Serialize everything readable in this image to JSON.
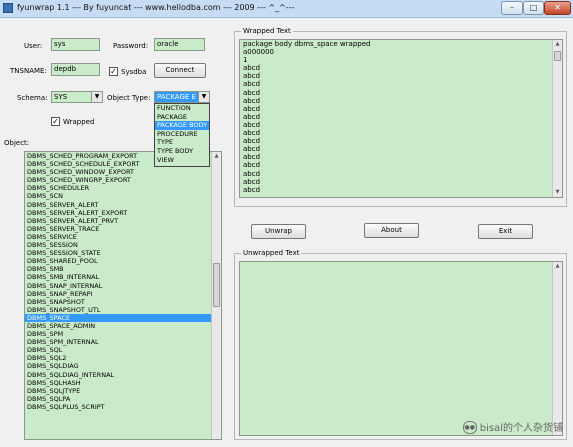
{
  "window": {
    "title": "fyunwrap 1.1 --- By fuyuncat --- www.hellodba.com --- 2009 --- ^_^---",
    "minimize_icon": "minimize-icon",
    "maximize_icon": "maximize-icon",
    "close_icon": "close-icon"
  },
  "login": {
    "user_label": "User:",
    "user_value": "sys",
    "password_label": "Password:",
    "password_value": "oracle",
    "tnsname_label": "TNSNAME:",
    "tnsname_value": "depdb",
    "sysdba_label": "Sysdba",
    "sysdba_checked": true,
    "connect_label": "Connect"
  },
  "schema": {
    "label": "Schema:",
    "value": "SYS"
  },
  "object_type": {
    "label": "Object Type:",
    "value": "PACKAGE E",
    "options": [
      "FUNCTION",
      "PACKAGE",
      "PACKAGE BODY",
      "PROCEDURE",
      "TYPE",
      "TYPE BODY",
      "VIEW"
    ],
    "selected_index": 2
  },
  "wrapped_checkbox": {
    "label": "Wrapped",
    "checked": true
  },
  "objects": {
    "label": "Object:",
    "items": [
      "DBMS_SCHED_PROGRAM_EXPORT",
      "DBMS_SCHED_SCHEDULE_EXPORT",
      "DBMS_SCHED_WINDOW_EXPORT",
      "DBMS_SCHED_WINGRP_EXPORT",
      "DBMS_SCHEDULER",
      "DBMS_SCN",
      "DBMS_SERVER_ALERT",
      "DBMS_SERVER_ALERT_EXPORT",
      "DBMS_SERVER_ALERT_PRVT",
      "DBMS_SERVER_TRACE",
      "DBMS_SERVICE",
      "DBMS_SESSION",
      "DBMS_SESSION_STATE",
      "DBMS_SHARED_POOL",
      "DBMS_SMB",
      "DBMS_SMB_INTERNAL",
      "DBMS_SNAP_INTERNAL",
      "DBMS_SNAP_REPAPI",
      "DBMS_SNAPSHOT",
      "DBMS_SNAPSHOT_UTL",
      "DBMS_SPACE",
      "DBMS_SPACE_ADMIN",
      "DBMS_SPM",
      "DBMS_SPM_INTERNAL",
      "DBMS_SQL",
      "DBMS_SQL2",
      "DBMS_SQLDIAG",
      "DBMS_SQLDIAG_INTERNAL",
      "DBMS_SQLHASH",
      "DBMS_SQLJTYPE",
      "DBMS_SQLPA",
      "DBMS_SQLPLUS_SCRIPT"
    ],
    "selected_index": 20
  },
  "wrapped_text": {
    "caption": "Wrapped Text",
    "lines": [
      "package body dbms_space wrapped",
      "a000000",
      "1",
      "abcd",
      "abcd",
      "abcd",
      "abcd",
      "abcd",
      "abcd",
      "abcd",
      "abcd",
      "abcd",
      "abcd",
      "abcd",
      "abcd",
      "abcd",
      "abcd",
      "abcd",
      "abcd"
    ]
  },
  "buttons": {
    "unwrap": "Unwrap",
    "about": "About",
    "exit": "Exit"
  },
  "unwrapped_text": {
    "caption": "Unwrapped Text"
  },
  "watermark": {
    "text": "bisal的个人杂货铺",
    "icon": "wechat-icon"
  },
  "colors": {
    "field_background": "#c9ebc9",
    "selection": "#3399ff",
    "titlebar": "#c6dcf4"
  }
}
